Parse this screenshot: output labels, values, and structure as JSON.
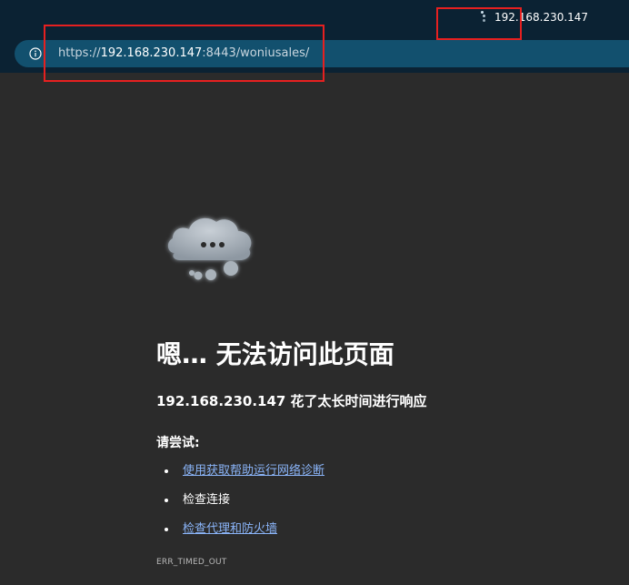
{
  "browser": {
    "tab_title": "192.168.230.147",
    "url": {
      "scheme": "https://",
      "host": "192.168.230.147",
      "rest": ":8443/woniusales/"
    }
  },
  "error_page": {
    "heading": "嗯… 无法访问此页面",
    "subheading": "192.168.230.147 花了太长时间进行响应",
    "try_label": "请尝试:",
    "suggestions": [
      "使用获取帮助运行网络诊断",
      "检查连接",
      "检查代理和防火墙"
    ],
    "error_code": "ERR_TIMED_OUT"
  },
  "colors": {
    "page_background": "#2b2b2b",
    "chrome_background": "#0b2233",
    "address_bar": "#12506e",
    "link": "#8ab4f8",
    "highlight": "#e62020"
  },
  "icons": [
    "loading-spinner-icon",
    "info-icon",
    "cloud-icon"
  ]
}
